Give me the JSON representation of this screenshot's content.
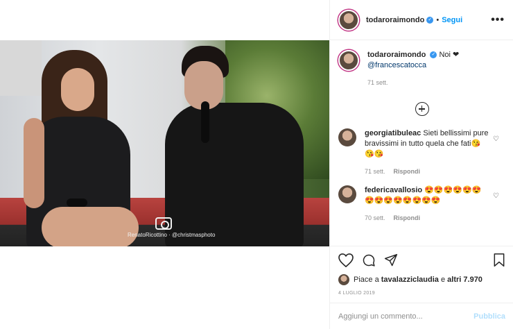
{
  "post": {
    "photo_watermark": "RenatoRicottino · @christmasphoto",
    "author": "todaroraimondo",
    "follow_label": "Segui",
    "separator": "•",
    "more_label": "•••"
  },
  "caption": {
    "username": "todaroraimondo",
    "text": "Noi ❤",
    "mention": "@francescatocca",
    "time": "71 sett."
  },
  "comments": [
    {
      "username": "georgiatibuleac",
      "text": "Sieti bellissimi pure bravissimi in tutto quela che fati😘😘😘",
      "time": "71 sett.",
      "reply_label": "Rispondi"
    },
    {
      "username": "federicavallosio",
      "text": "😍😍😍😍😍😍😍😍😍😍😍😍😍😍",
      "time": "70 sett.",
      "reply_label": "Rispondi"
    }
  ],
  "likes": {
    "prefix": "Piace a",
    "user": "tavalazziclaudia",
    "conj": "e",
    "others": "altri 7.970"
  },
  "date": "4 LUGLIO 2019",
  "comment_box": {
    "placeholder": "Aggiungi un commento...",
    "publish_label": "Pubblica"
  },
  "icons": {
    "like": "heart-icon",
    "comment": "comment-icon",
    "share": "share-icon",
    "save": "bookmark-icon",
    "verified": "verified-badge-icon",
    "add": "plus-circle-icon"
  },
  "colors": {
    "accent": "#0095f6",
    "verified": "#3897f0",
    "muted": "#8e8e8e",
    "publish_disabled": "#b2dffc"
  }
}
